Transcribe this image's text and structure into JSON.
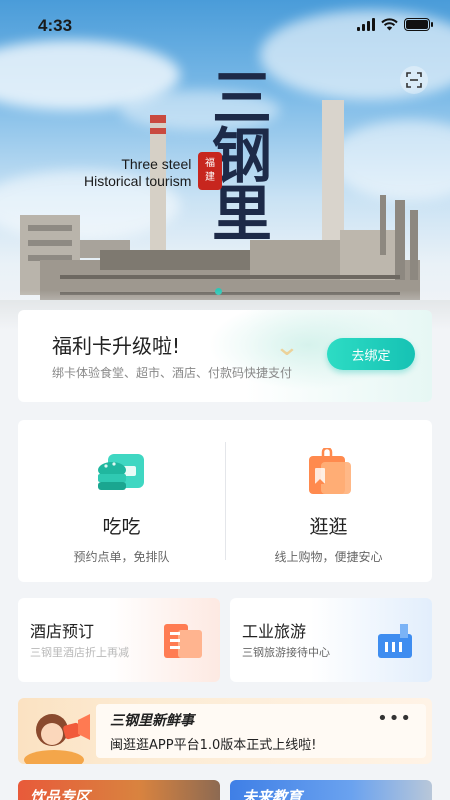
{
  "status_bar": {
    "time": "4:33"
  },
  "hero": {
    "title_en_line1": "Three steel",
    "title_en_line2": "Historical tourism",
    "title_cn": [
      "三",
      "钢",
      "里"
    ],
    "seal_text": [
      "福",
      "建"
    ]
  },
  "welfare": {
    "title": "福利卡升级啦!",
    "subtitle": "绑卡体验食堂、超市、酒店、付款码快捷支付",
    "button": "去绑定"
  },
  "services": [
    {
      "name": "吃吃",
      "desc": "预约点单，免排队",
      "icon": "food-icon"
    },
    {
      "name": "逛逛",
      "desc": "线上购物，便捷安心",
      "icon": "shopping-bag-icon"
    }
  ],
  "tiles": [
    {
      "title": "酒店预订",
      "subtitle": "三钢里酒店折上再减",
      "icon": "hotel-icon"
    },
    {
      "title": "工业旅游",
      "subtitle": "三钢旅游接待中心",
      "icon": "factory-icon"
    }
  ],
  "news": {
    "title": "三钢里新鲜事",
    "body": "闽逛逛APP平台1.0版本正式上线啦!",
    "more": "•••"
  },
  "bottom_cards": [
    {
      "title": "饮品专区"
    },
    {
      "title": "未来教育"
    }
  ],
  "colors": {
    "accent_teal": "#16c2b4",
    "seal_red": "#c7261e",
    "title_navy": "#1d2a48"
  }
}
